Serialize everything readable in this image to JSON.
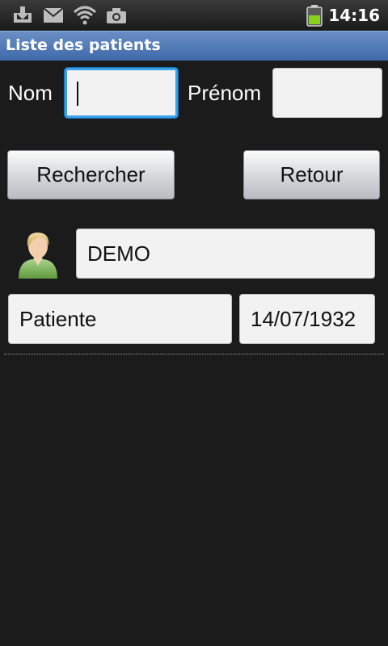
{
  "status_bar": {
    "time": "14:16",
    "icons": [
      "download-icon",
      "mail-icon",
      "wifi-icon",
      "camera-icon",
      "battery-icon"
    ]
  },
  "title_bar": {
    "title": "Liste des patients"
  },
  "search_form": {
    "nom_label": "Nom",
    "nom_value": "",
    "prenom_label": "Prénom",
    "prenom_value": "",
    "search_button": "Rechercher",
    "back_button": "Retour"
  },
  "results": [
    {
      "avatar_icon": "user-avatar-icon",
      "last_name": "DEMO",
      "first_name": "Patiente",
      "birth_date": "14/07/1932"
    }
  ],
  "colors": {
    "title_bar": "#3e69a9",
    "focus_border": "#39a0e8",
    "background": "#1b1b1b"
  }
}
